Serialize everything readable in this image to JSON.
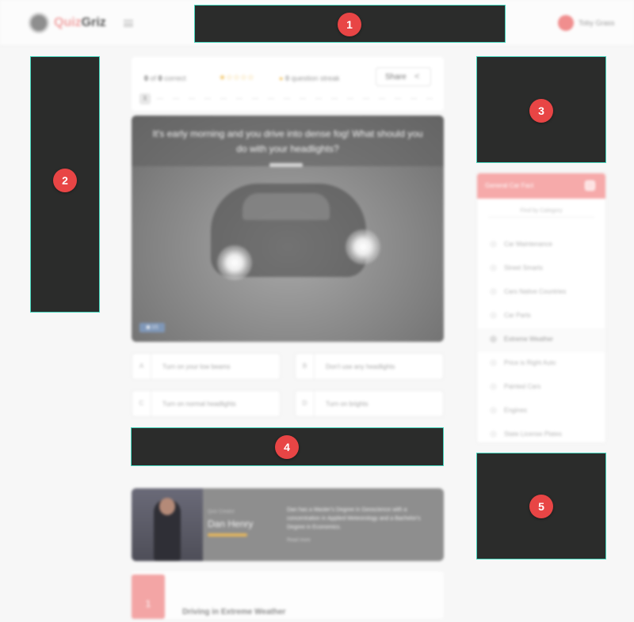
{
  "header": {
    "logo_text": "Quiz",
    "logo_text_accent": "Griz",
    "user_name": "Toby Grass"
  },
  "status": {
    "score_correct": "0",
    "score_total": "0",
    "score_suffix": "correct",
    "score_of": "of",
    "stars": "★☆☆☆☆",
    "streak_dot": "●",
    "streak_count": "0",
    "streak_label": "question streak",
    "share_label": "Share",
    "current_question": "1"
  },
  "question": {
    "text": "It's early morning and you drive into dense fog! What should you do with your headlights?",
    "photo_credit": "▣ 1/1"
  },
  "answers": [
    {
      "letter": "A",
      "text": "Turn on your low beams"
    },
    {
      "letter": "B",
      "text": "Don't use any headlights"
    },
    {
      "letter": "C",
      "text": "Turn on normal headlights"
    },
    {
      "letter": "D",
      "text": "Turn on brights"
    }
  ],
  "author": {
    "role": "Quiz Creator",
    "name": "Dan Henry",
    "bio": "Dan has a Master's Degree in Geoscience with a concentration in Applied Meteorology and a Bachelor's Degree in Economics.",
    "more": "Read more"
  },
  "article": {
    "badge": "1",
    "title": "Driving in Extreme Weather"
  },
  "categories": {
    "title": "General Car Fact",
    "search_placeholder": "Find by Category",
    "items": [
      {
        "label": "Car Maintenance"
      },
      {
        "label": "Street Smarts"
      },
      {
        "label": "Cars Native Countries"
      },
      {
        "label": "Car Parts"
      },
      {
        "label": "Extreme Weather"
      },
      {
        "label": "Price is Right Auto"
      },
      {
        "label": "Painted Cars"
      },
      {
        "label": "Engines"
      },
      {
        "label": "State License Plates"
      }
    ],
    "active_index": 4
  },
  "redactions": [
    {
      "label": "1"
    },
    {
      "label": "2"
    },
    {
      "label": "3"
    },
    {
      "label": "4"
    },
    {
      "label": "5"
    }
  ],
  "colors": {
    "brand": "#f1a4a4",
    "accent_gold": "#e4b55d",
    "redaction_fill": "#2b2c2b",
    "redaction_border": "#47d6bd",
    "marker": "#e84545"
  }
}
